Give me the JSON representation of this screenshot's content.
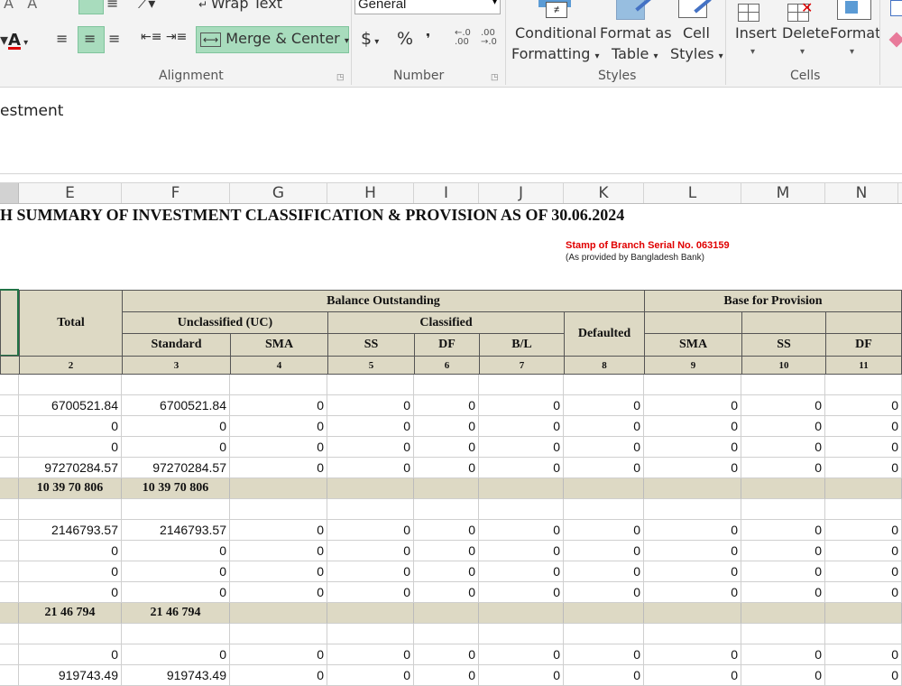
{
  "ribbon": {
    "alignment": {
      "wrap_text": "Wrap Text",
      "merge_center": "Merge & Center",
      "group_label": "Alignment"
    },
    "number": {
      "format_value": "General",
      "currency": "$",
      "percent": "%",
      "comma": "❜",
      "group_label": "Number"
    },
    "styles": {
      "conditional_1": "Conditional",
      "conditional_2": "Formatting",
      "format_as_1": "Format as",
      "format_as_2": "Table",
      "cell_styles_1": "Cell",
      "cell_styles_2": "Styles",
      "group_label": "Styles"
    },
    "cells": {
      "insert": "Insert",
      "delete": "Delete",
      "format": "Format",
      "group_label": "Cells"
    }
  },
  "formula_bar": {
    "content": "estment"
  },
  "columns": [
    "E",
    "F",
    "G",
    "H",
    "I",
    "J",
    "K",
    "L",
    "M",
    "N"
  ],
  "sheet": {
    "title": "H SUMMARY OF INVESTMENT CLASSIFICATION & PROVISION AS OF 30.06.2024",
    "stamp": "Stamp of Branch Serial No. 063159",
    "stamp_sub": "(As provided by Bangladesh Bank)",
    "headers": {
      "total": "Total",
      "balance_outstanding": "Balance Outstanding",
      "unclassified": "Unclassified (UC)",
      "classified": "Classified",
      "defaulted": "Defaulted",
      "standard": "Standard",
      "sma": "SMA",
      "ss": "SS",
      "df": "DF",
      "bl": "B/L",
      "base_for_provision": "Base for Provision",
      "sma2": "SMA",
      "ss2": "SS",
      "df2": "DF"
    },
    "col_numbers": [
      "2",
      "3",
      "4",
      "5",
      "6",
      "7",
      "8",
      "9",
      "10",
      "11"
    ],
    "rows": [
      {
        "type": "blank"
      },
      {
        "type": "data",
        "v": [
          "6700521.84",
          "6700521.84",
          "0",
          "0",
          "0",
          "0",
          "0",
          "0",
          "0",
          "0"
        ]
      },
      {
        "type": "data",
        "v": [
          "0",
          "0",
          "0",
          "0",
          "0",
          "0",
          "0",
          "0",
          "0",
          "0"
        ]
      },
      {
        "type": "data",
        "v": [
          "0",
          "0",
          "0",
          "0",
          "0",
          "0",
          "0",
          "0",
          "0",
          "0"
        ]
      },
      {
        "type": "data",
        "v": [
          "97270284.57",
          "97270284.57",
          "0",
          "0",
          "0",
          "0",
          "0",
          "0",
          "0",
          "0"
        ]
      },
      {
        "type": "sub",
        "v": [
          "10 39 70 806",
          "10 39 70 806"
        ]
      },
      {
        "type": "blank"
      },
      {
        "type": "data",
        "v": [
          "2146793.57",
          "2146793.57",
          "0",
          "0",
          "0",
          "0",
          "0",
          "0",
          "0",
          "0"
        ]
      },
      {
        "type": "data",
        "v": [
          "0",
          "0",
          "0",
          "0",
          "0",
          "0",
          "0",
          "0",
          "0",
          "0"
        ]
      },
      {
        "type": "data",
        "v": [
          "0",
          "0",
          "0",
          "0",
          "0",
          "0",
          "0",
          "0",
          "0",
          "0"
        ]
      },
      {
        "type": "data",
        "v": [
          "0",
          "0",
          "0",
          "0",
          "0",
          "0",
          "0",
          "0",
          "0",
          "0"
        ]
      },
      {
        "type": "sub",
        "v": [
          "21 46 794",
          "21 46 794"
        ]
      },
      {
        "type": "blank"
      },
      {
        "type": "data",
        "v": [
          "0",
          "0",
          "0",
          "0",
          "0",
          "0",
          "0",
          "0",
          "0",
          "0"
        ]
      },
      {
        "type": "data",
        "v": [
          "919743.49",
          "919743.49",
          "0",
          "0",
          "0",
          "0",
          "0",
          "0",
          "0",
          "0"
        ]
      }
    ]
  }
}
